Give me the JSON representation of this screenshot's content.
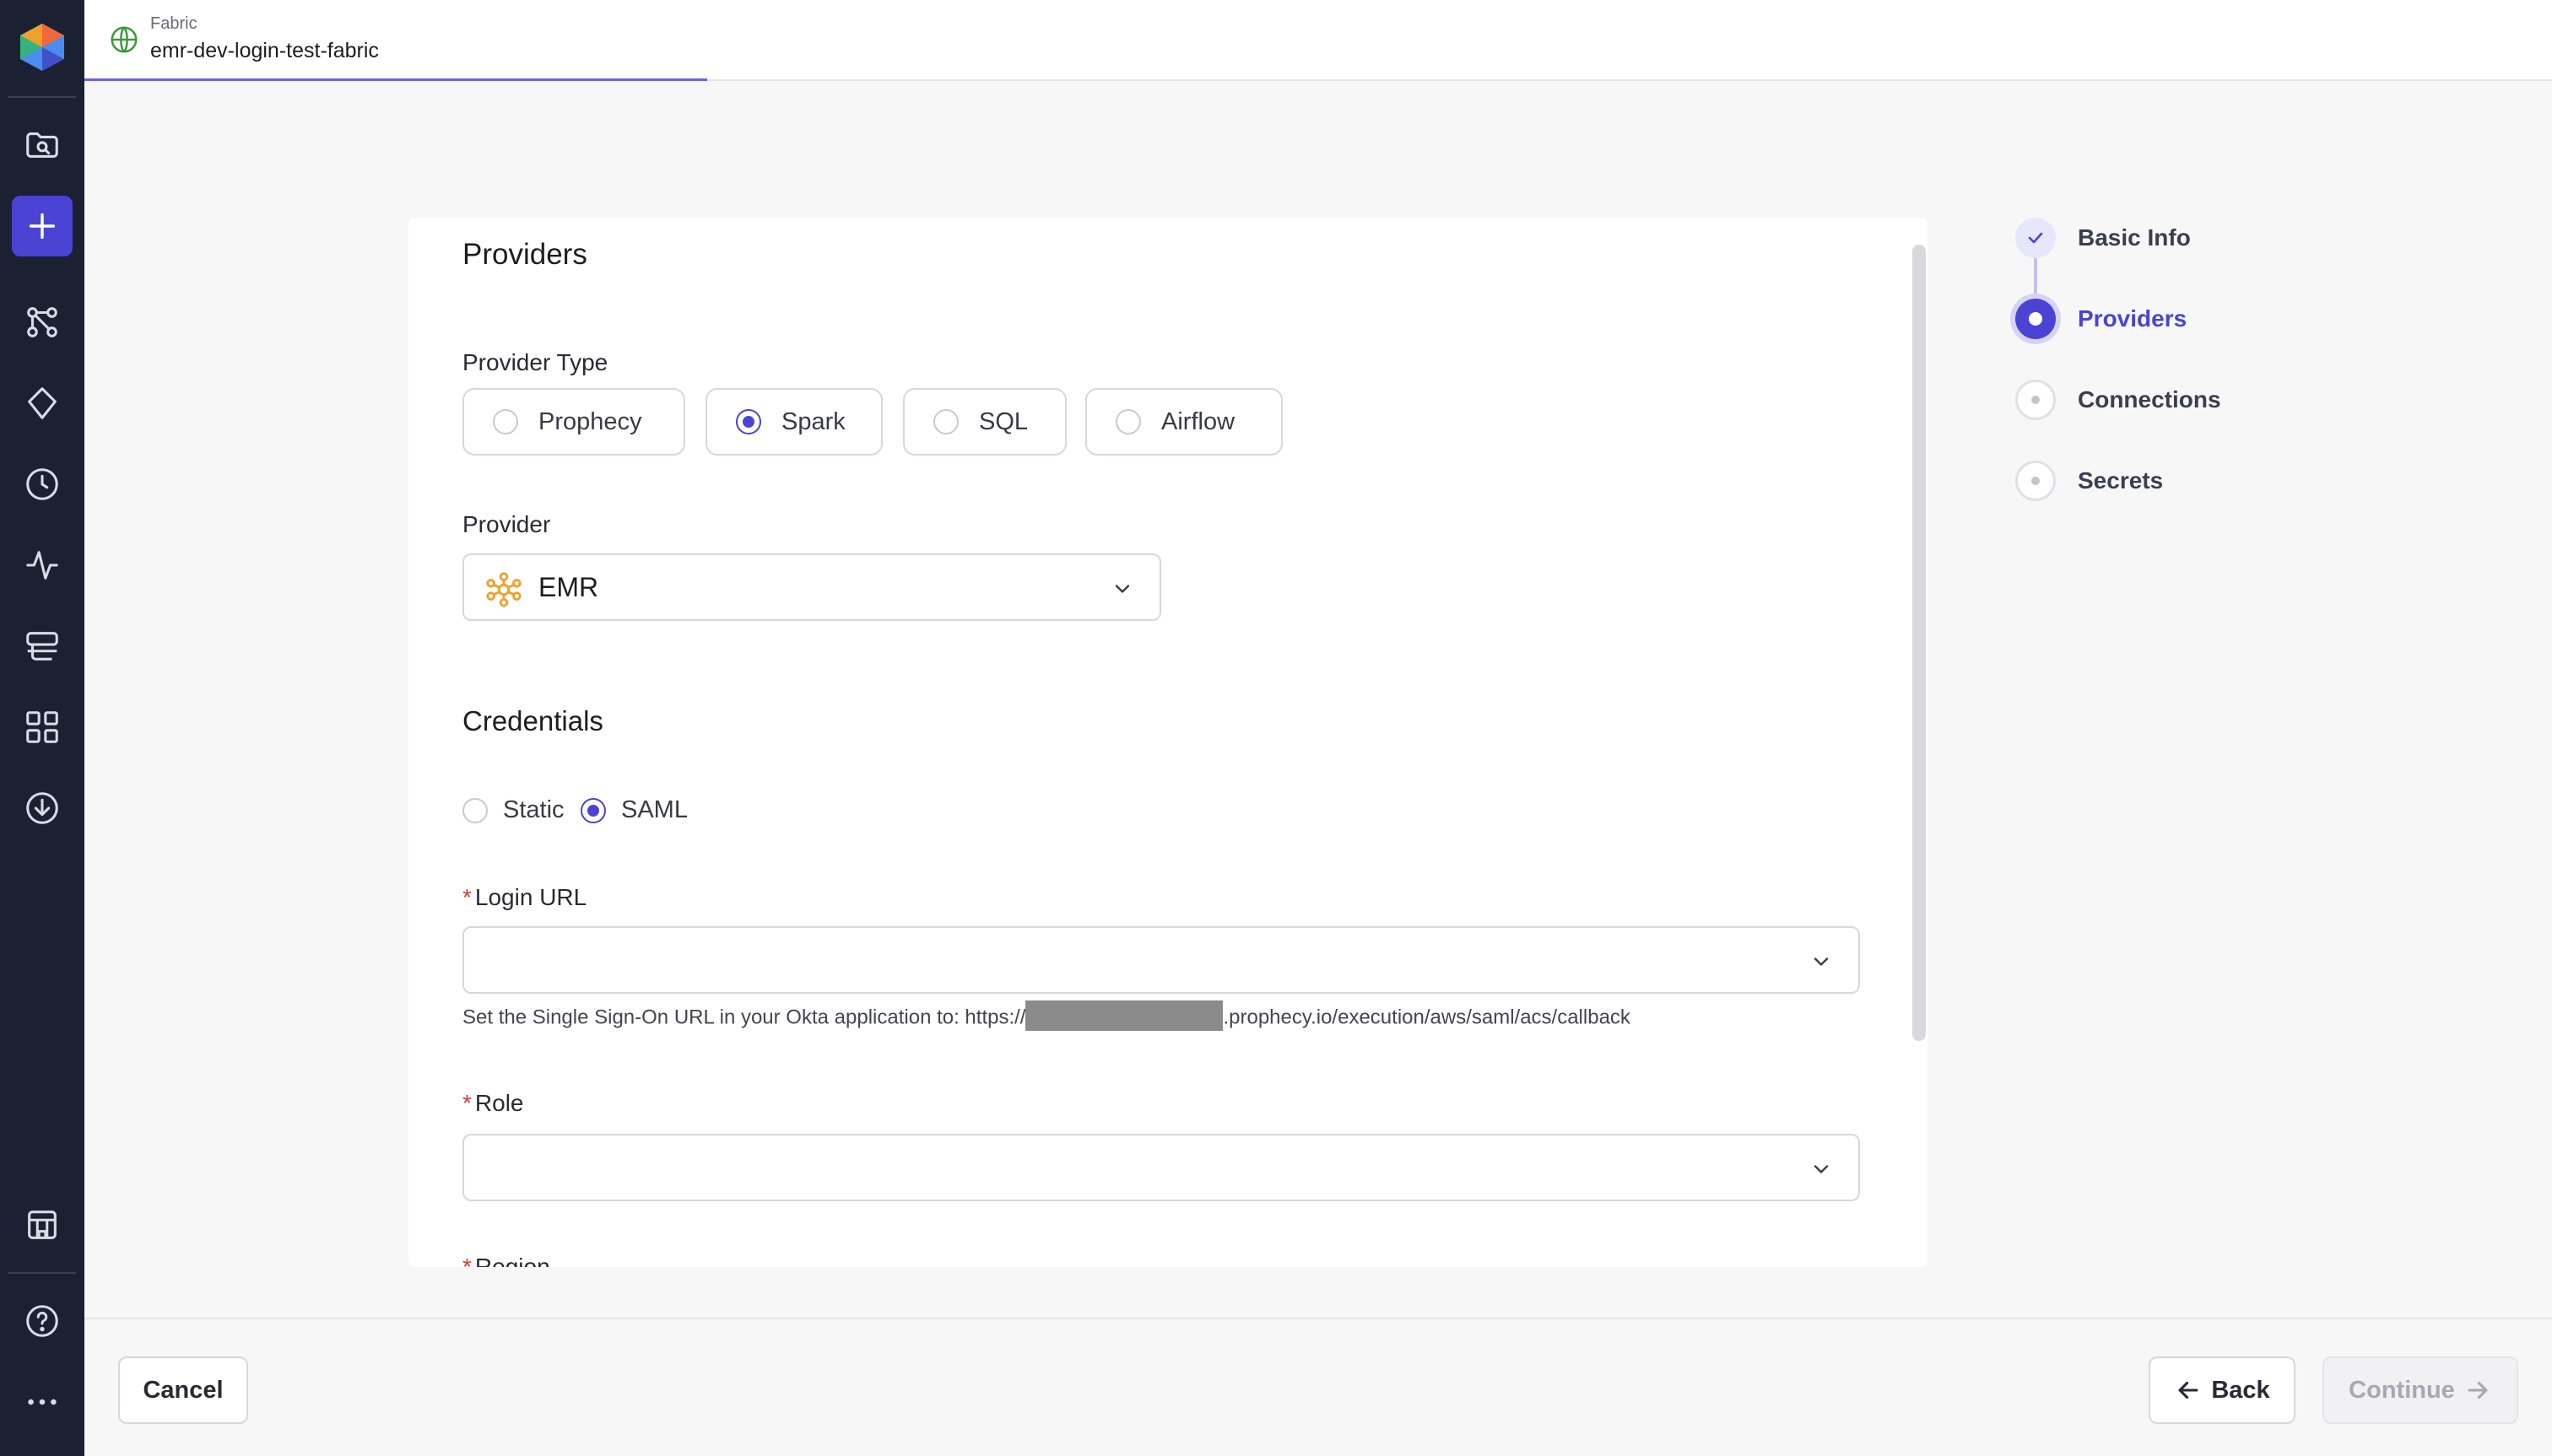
{
  "topbar": {
    "kind": "Fabric",
    "name": "emr-dev-login-test-fabric"
  },
  "nav": {
    "items": [
      "logo",
      "search-files-icon",
      "plus-icon",
      "graph-icon",
      "gem-icon",
      "clock-icon",
      "activity-icon",
      "server-icon",
      "grid-icon",
      "download-icon",
      "building-icon",
      "help-icon",
      "more-icon"
    ]
  },
  "providers": {
    "title": "Providers",
    "provider_type_label": "Provider Type",
    "provider_types": [
      "Prophecy",
      "Spark",
      "SQL",
      "Airflow"
    ],
    "selected_provider_type": "Spark",
    "provider_label": "Provider",
    "provider_value": "EMR"
  },
  "credentials": {
    "title": "Credentials",
    "options": [
      "Static",
      "SAML"
    ],
    "selected": "SAML",
    "required_mark": "*",
    "login_url_label": "Login URL",
    "login_url_value": "",
    "helper_prefix": "Set the Single Sign-On URL in your Okta application to: https://",
    "helper_suffix": ".prophecy.io/execution/aws/saml/acs/callback",
    "role_label": "Role",
    "role_value": "",
    "region_label": "Region"
  },
  "stepper": {
    "steps": [
      "Basic Info",
      "Providers",
      "Connections",
      "Secrets"
    ],
    "current": "Providers"
  },
  "footer": {
    "cancel": "Cancel",
    "back": "Back",
    "continue": "Continue"
  },
  "colors": {
    "accent": "#4b43d4",
    "nav_bg": "#1c2033",
    "emr_orange": "#f0a12b",
    "globe_green": "#3c9a3c"
  }
}
